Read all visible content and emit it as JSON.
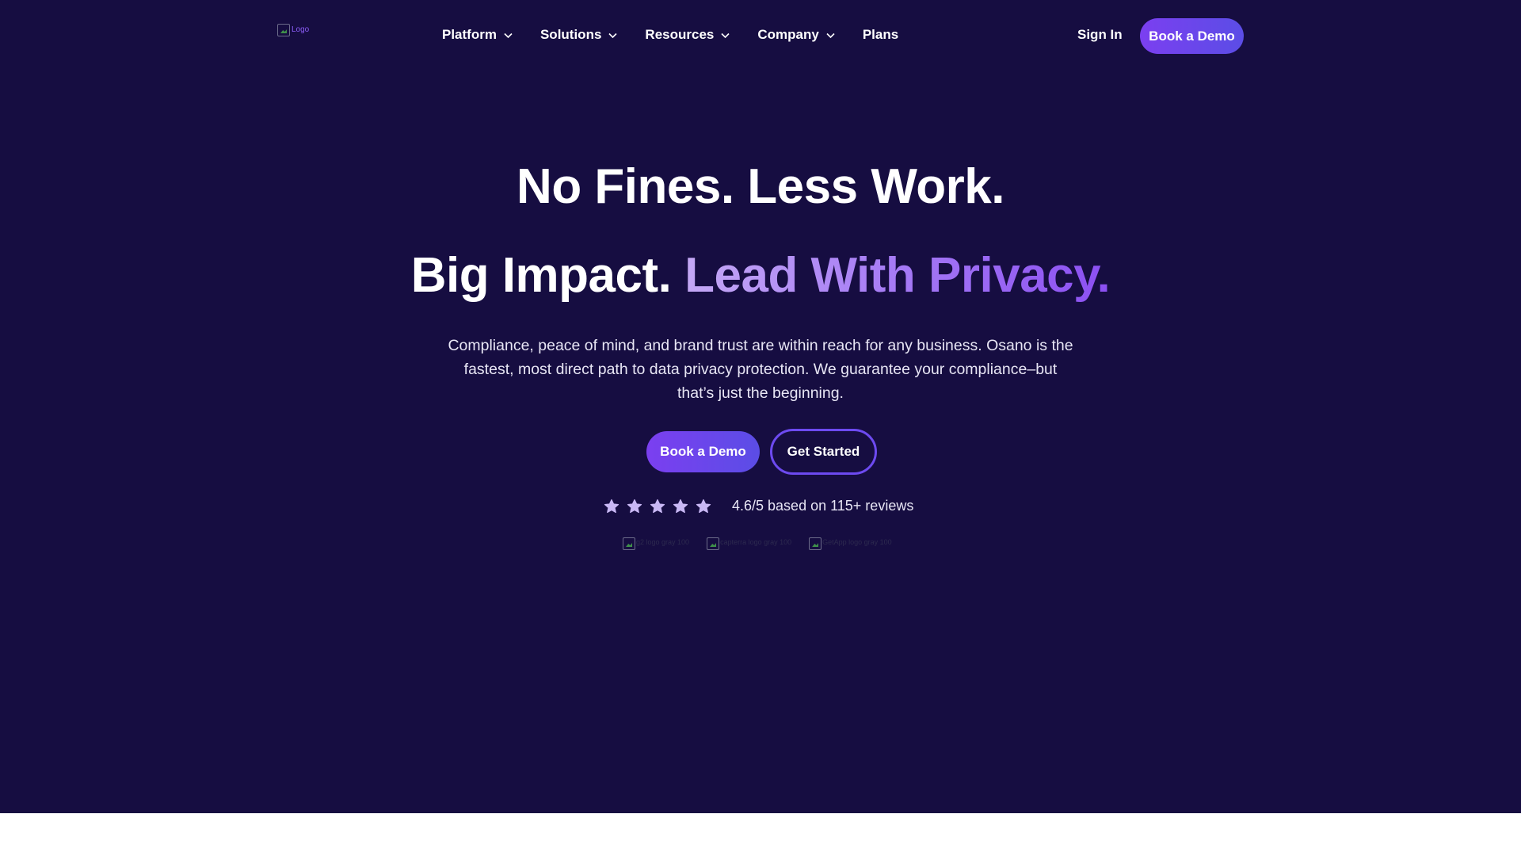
{
  "header": {
    "logo_alt": "Logo",
    "nav": [
      {
        "label": "Platform",
        "has_dropdown": true
      },
      {
        "label": "Solutions",
        "has_dropdown": true
      },
      {
        "label": "Resources",
        "has_dropdown": true
      },
      {
        "label": "Company",
        "has_dropdown": true
      },
      {
        "label": "Plans",
        "has_dropdown": false
      }
    ],
    "sign_in": "Sign In",
    "cta": "Book a Demo"
  },
  "hero": {
    "title_line1": "No Fines. Less Work.",
    "title_line2_plain": "Big Impact.",
    "title_line2_accent": "Lead With Privacy.",
    "description": "Compliance, peace of mind, and brand trust are within reach for any business. Osano is the fastest, most direct path to data privacy protection. We guarantee your compliance–but that’s just the beginning.",
    "primary_cta": "Book a Demo",
    "secondary_cta": "Get Started",
    "rating": {
      "stars": 5,
      "star_icon": "star-icon",
      "text": "4.6/5 based on 115+ reviews"
    },
    "review_logos": [
      {
        "alt": "g2 logo gray 100"
      },
      {
        "alt": "capterra logo gray 100"
      },
      {
        "alt": "GetApp logo gray 100"
      }
    ]
  },
  "colors": {
    "background": "#160d41",
    "accent": "#7b3ff0",
    "accent_text": "#a57af5",
    "star": "#c9b8f5",
    "footer_band": "#ffffff"
  }
}
